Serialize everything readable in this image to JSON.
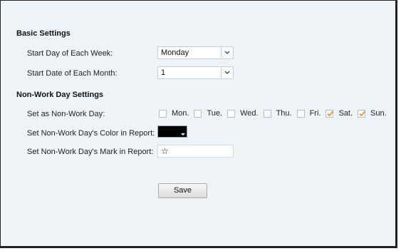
{
  "basic": {
    "title": "Basic Settings",
    "start_day_label": "Start Day of Each Week:",
    "start_day_value": "Monday",
    "start_date_label": "Start Date of Each Month:",
    "start_date_value": "1"
  },
  "nonwork": {
    "title": "Non-Work Day Settings",
    "set_label": "Set as Non-Work Day:",
    "days": [
      {
        "label": "Mon.",
        "checked": false
      },
      {
        "label": "Tue.",
        "checked": false
      },
      {
        "label": "Wed.",
        "checked": false
      },
      {
        "label": "Thu.",
        "checked": false
      },
      {
        "label": "Fri.",
        "checked": false
      },
      {
        "label": "Sat.",
        "checked": true
      },
      {
        "label": "Sun.",
        "checked": true
      }
    ],
    "color_label": "Set Non-Work Day's Color in Report:",
    "color_value": "#000000",
    "mark_label": "Set Non-Work Day's Mark in Report:",
    "mark_value": "☆"
  },
  "actions": {
    "save_label": "Save"
  },
  "colors": {
    "panel_bg": "#eef3f8",
    "check_mark": "#e08a1e"
  }
}
